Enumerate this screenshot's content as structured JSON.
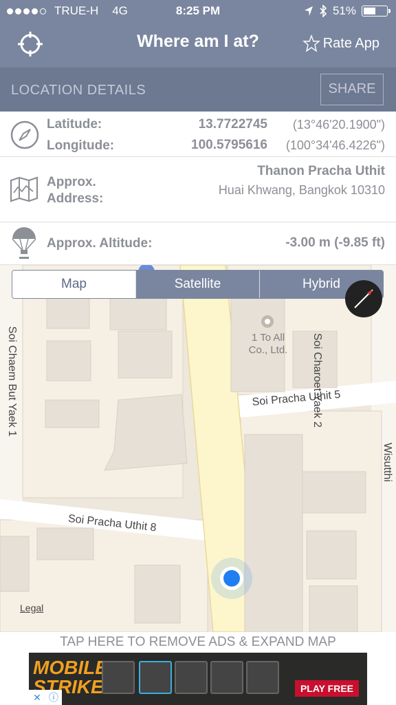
{
  "status_bar": {
    "carrier": "TRUE-H",
    "network": "4G",
    "time": "8:25 PM",
    "battery": "51%",
    "battery_level": 0.51,
    "icons": [
      "location-arrow-icon",
      "bluetooth-icon",
      "battery-icon"
    ]
  },
  "nav": {
    "title": "Where am I at?",
    "rate_label": "Rate App",
    "left_icon": "crosshair-icon",
    "rate_icon": "star-outline-icon"
  },
  "section": {
    "title": "LOCATION DETAILS",
    "share_label": "SHARE"
  },
  "coordinates": {
    "latitude_label": "Latitude:",
    "latitude_value": "13.7722745",
    "latitude_dms": "(13°46'20.1900\")",
    "longitude_label": "Longitude:",
    "longitude_value": "100.5795616",
    "longitude_dms": "(100°34'46.4226\")",
    "icon": "compass-icon"
  },
  "address": {
    "label_line1": "Approx.",
    "label_line2": "Address:",
    "street": "Thanon Pracha Uthit",
    "district": "Huai Khwang, Bangkok 10310",
    "icon": "map-icon"
  },
  "altitude": {
    "label": "Approx. Altitude:",
    "value": "-3.00 m (-9.85 ft)",
    "icon": "balloon-icon"
  },
  "map": {
    "tabs": [
      {
        "label": "Map",
        "active": true
      },
      {
        "label": "Satellite",
        "active": false
      },
      {
        "label": "Hybrid",
        "active": false
      }
    ],
    "labels": {
      "soi_cham_but": "Soi Chaem But Yaek 1",
      "poi_line1": "1 To All",
      "poi_line2": "Co., Ltd.",
      "soi_uthit5": "Soi Pracha Uthit 5",
      "soi_uthit8": "Soi Pracha Uthit 8",
      "yaek2": "Soi Charoet Yaek 2",
      "wisutthi": "Soi Wisutthi"
    },
    "legal": "Legal",
    "colors": {
      "land": "#ede7dc",
      "block": "#f6efe4",
      "building": "#e6e0d6",
      "main_road": "#fdf6cc",
      "location_dot": "#1e7ef2"
    }
  },
  "ads": {
    "remove_text": "TAP HERE TO REMOVE ADS & EXPAND MAP",
    "brand_line1": "MOBILE",
    "brand_line2": "STRIKE",
    "cta": "PLAY FREE"
  }
}
